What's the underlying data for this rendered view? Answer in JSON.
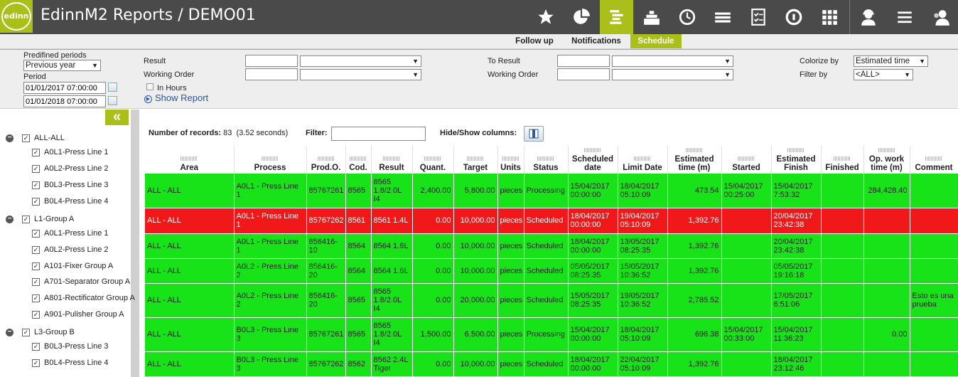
{
  "app": {
    "logo_text": "edinn",
    "title": "EdinnM2 Reports / DEMO01"
  },
  "toolbar_icons": [
    "star-icon",
    "pie-chart-icon",
    "gantt-icon",
    "factory-icon",
    "clock-icon",
    "money-icon",
    "checklist-icon",
    "q-icon",
    "grid-icon",
    "support-agent-icon",
    "menu-icon",
    "users-icon"
  ],
  "subtabs": [
    {
      "label": "Follow up",
      "active": false
    },
    {
      "label": "Notifications",
      "active": false
    },
    {
      "label": "Schedule",
      "active": true
    }
  ],
  "filters": {
    "predefined_label": "Predifined periods",
    "predefined_value": "Previous year",
    "period_label": "Period",
    "period_from": "01/01/2017 07:00:00",
    "period_to": "01/01/2018 07:00:00",
    "result_label": "Result",
    "working_order_label": "Working Order",
    "in_hours_label": "In Hours",
    "show_report_label": "Show Report",
    "to_result_label": "To Result",
    "to_working_order_label": "Working Order",
    "colorize_label": "Colorize by",
    "colorize_value": "Estimated time",
    "filter_by_label": "Filter by",
    "filter_by_value": "<ALL>"
  },
  "tree": [
    {
      "label": "ALL-ALL",
      "level": 0
    },
    {
      "label": "A0L1-Press Line 1",
      "level": 1
    },
    {
      "label": "A0L2-Press Line 2",
      "level": 1
    },
    {
      "label": "B0L3-Press Line 3",
      "level": 1
    },
    {
      "label": "B0L4-Press Line 4",
      "level": 1
    },
    {
      "label": "L1-Group A",
      "level": 0
    },
    {
      "label": "A0L1-Press Line 1",
      "level": 1
    },
    {
      "label": "A0L2-Press Line 2",
      "level": 1
    },
    {
      "label": "A101-Fixer Group A",
      "level": 1
    },
    {
      "label": "A701-Separator Group A",
      "level": 1
    },
    {
      "label": "A801-Rectificator Group A",
      "level": 1
    },
    {
      "label": "A901-Pulisher Group A",
      "level": 1
    },
    {
      "label": "L3-Group B",
      "level": 0
    },
    {
      "label": "B0L3-Press Line 3",
      "level": 1
    },
    {
      "label": "B0L4-Press Line 4",
      "level": 1
    }
  ],
  "records": {
    "label": "Number of records:",
    "count": "83",
    "time": "(3.52 seconds)",
    "filter_label": "Filter:",
    "hide_show_label": "Hide/Show columns:"
  },
  "columns": [
    "Area",
    "Process",
    "Prod.O.",
    "Cod.",
    "Result",
    "Quant.",
    "Target",
    "Units",
    "Status",
    "Scheduled date",
    "Limit Date",
    "Estimated time (m)",
    "Started",
    "Estimated Finish",
    "Finished",
    "Op. work time (m)",
    "Comment"
  ],
  "rows": [
    {
      "color": "g",
      "cells": [
        "ALL - ALL",
        "A0L1 - Press Line 1",
        "85767261",
        "8565",
        "8565 1.8/2.0L I4",
        "2,400.00",
        "5,800.00",
        "pieces",
        "Processing",
        "15/04/2017 00:00:00",
        "18/04/2017 05:10:09",
        "473.54",
        "15/04/2017 00:25:00",
        "15/04/2017 7:53:32",
        "",
        "284,428.40",
        ""
      ]
    },
    {
      "color": "r",
      "cells": [
        "ALL - ALL",
        "A0L1 - Press Line 1",
        "85767262",
        "8561",
        "8561 1.4L",
        "0.00",
        "10,000.00",
        "pieces",
        "Scheduled",
        "18/04/2017 00:00:00",
        "19/04/2017 05:10:09",
        "1,392.76",
        "",
        "20/04/2017 23:42:38",
        "",
        "",
        ""
      ]
    },
    {
      "color": "g",
      "cells": [
        "ALL - ALL",
        "A0L1 - Press Line 1",
        "856416-10",
        "8564",
        "8564 1.6L",
        "0.00",
        "10,000.00",
        "pieces",
        "Scheduled",
        "18/04/2017 00:00:00",
        "13/05/2017 08:25:35",
        "1,392.76",
        "",
        "20/04/2017 23:42:38",
        "",
        "",
        ""
      ]
    },
    {
      "color": "g",
      "cells": [
        "ALL - ALL",
        "A0L2 - Press Line 2",
        "856416-20",
        "8564",
        "8564 1.6L",
        "0.00",
        "10,000.00",
        "pieces",
        "Scheduled",
        "05/05/2017 08:25:35",
        "15/05/2017 10:36:52",
        "1,392.76",
        "",
        "05/05/2017 19:16:18",
        "",
        "",
        ""
      ]
    },
    {
      "color": "g",
      "cells": [
        "ALL - ALL",
        "A0L2 - Press Line 2",
        "856416-20",
        "8565",
        "8565 1.8/2.0L I4",
        "0.00",
        "20,000.00",
        "pieces",
        "Scheduled",
        "15/05/2017 08:25:35",
        "19/05/2017 10:36:52",
        "2,785.52",
        "",
        "17/05/2017 6:51:06",
        "",
        "",
        "Esto es una prueba"
      ]
    },
    {
      "color": "g",
      "cells": [
        "ALL - ALL",
        "B0L3 - Press Line 3",
        "85767261",
        "8565",
        "8565 1.8/2.0L I4",
        "1,500.00",
        "6,500.00",
        "pieces",
        "Processing",
        "15/04/2017 00:00:00",
        "18/04/2017 05:10:09",
        "696.38",
        "15/04/2017 00:33:00",
        "15/04/2017 11:36:23",
        "",
        "0.00",
        ""
      ]
    },
    {
      "color": "g",
      "cells": [
        "ALL - ALL",
        "B0L3 - Press Line 3",
        "85767262",
        "8562",
        "8562 2.4L Tiger",
        "0.00",
        "10,000.00",
        "pieces",
        "Scheduled",
        "18/04/2017 00:00:00",
        "22/04/2017 05:10:09",
        "1,392.76",
        "",
        "18/04/2017 23:12:46",
        "",
        "",
        ""
      ]
    }
  ]
}
